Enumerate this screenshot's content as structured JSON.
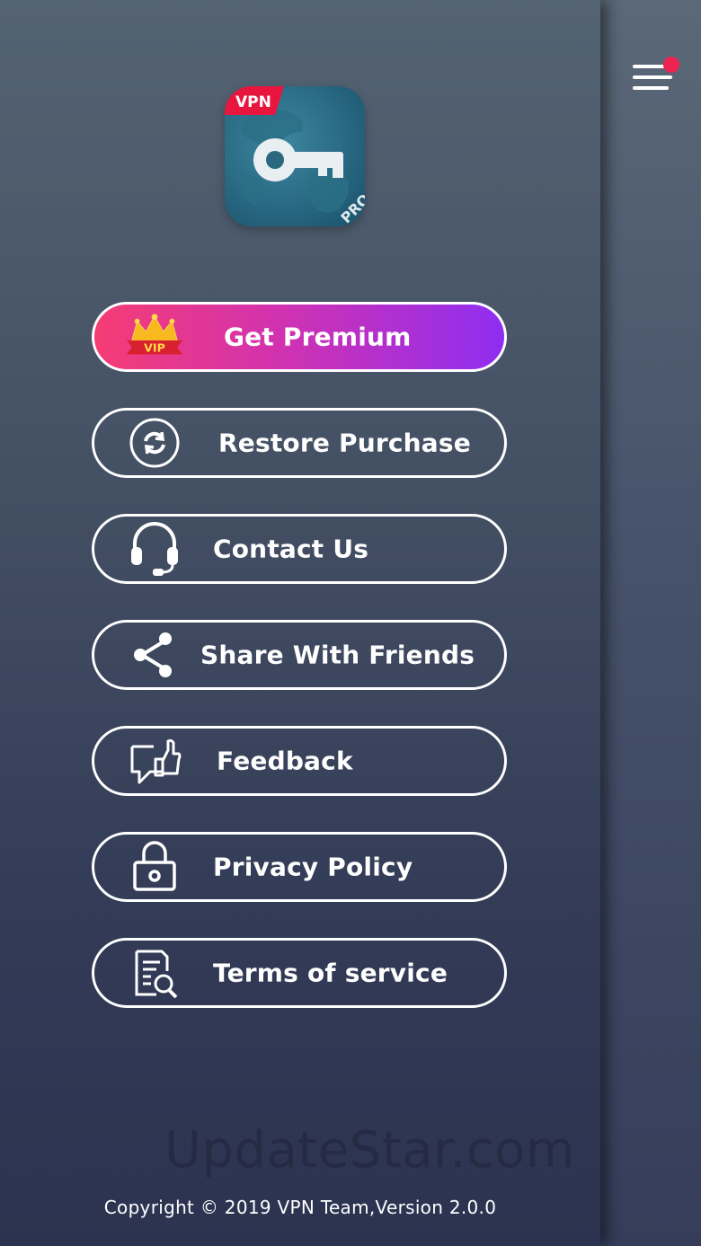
{
  "logo": {
    "badge": "VPN",
    "tag": "PRO"
  },
  "menu": {
    "items": [
      {
        "label": "Get Premium",
        "icon": "crown-vip-icon",
        "badge": "VIP"
      },
      {
        "label": "Restore Purchase",
        "icon": "restore-icon"
      },
      {
        "label": "Contact Us",
        "icon": "headset-icon"
      },
      {
        "label": "Share With Friends",
        "icon": "share-icon"
      },
      {
        "label": "Feedback",
        "icon": "feedback-thumbs-up-icon"
      },
      {
        "label": "Privacy Policy",
        "icon": "lock-icon"
      },
      {
        "label": "Terms of service",
        "icon": "document-search-icon"
      }
    ]
  },
  "watermark": "UpdateStar.com",
  "footer": {
    "copyright": "Copyright © 2019 VPN Team,Version 2.0.0"
  },
  "colors": {
    "premium_gradient_start": "#f53c74",
    "premium_gradient_end": "#8f2ef0",
    "notification_dot": "#ef2352",
    "logo_badge": "#e8153f"
  }
}
